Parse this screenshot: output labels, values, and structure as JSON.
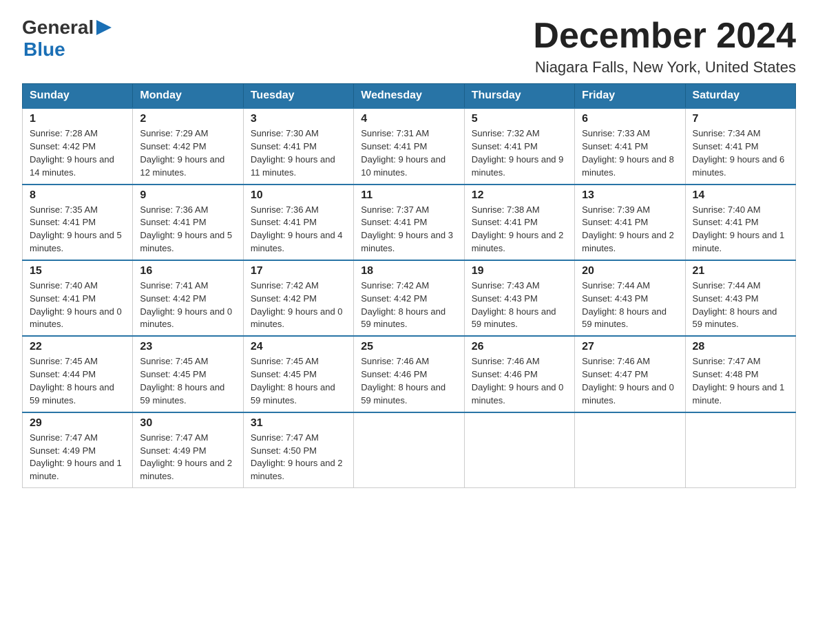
{
  "logo": {
    "general": "General",
    "blue": "Blue",
    "arrow_shape": "▶"
  },
  "header": {
    "title": "December 2024",
    "subtitle": "Niagara Falls, New York, United States"
  },
  "weekdays": [
    "Sunday",
    "Monday",
    "Tuesday",
    "Wednesday",
    "Thursday",
    "Friday",
    "Saturday"
  ],
  "weeks": [
    [
      {
        "day": "1",
        "sunrise": "7:28 AM",
        "sunset": "4:42 PM",
        "daylight": "9 hours and 14 minutes."
      },
      {
        "day": "2",
        "sunrise": "7:29 AM",
        "sunset": "4:42 PM",
        "daylight": "9 hours and 12 minutes."
      },
      {
        "day": "3",
        "sunrise": "7:30 AM",
        "sunset": "4:41 PM",
        "daylight": "9 hours and 11 minutes."
      },
      {
        "day": "4",
        "sunrise": "7:31 AM",
        "sunset": "4:41 PM",
        "daylight": "9 hours and 10 minutes."
      },
      {
        "day": "5",
        "sunrise": "7:32 AM",
        "sunset": "4:41 PM",
        "daylight": "9 hours and 9 minutes."
      },
      {
        "day": "6",
        "sunrise": "7:33 AM",
        "sunset": "4:41 PM",
        "daylight": "9 hours and 8 minutes."
      },
      {
        "day": "7",
        "sunrise": "7:34 AM",
        "sunset": "4:41 PM",
        "daylight": "9 hours and 6 minutes."
      }
    ],
    [
      {
        "day": "8",
        "sunrise": "7:35 AM",
        "sunset": "4:41 PM",
        "daylight": "9 hours and 5 minutes."
      },
      {
        "day": "9",
        "sunrise": "7:36 AM",
        "sunset": "4:41 PM",
        "daylight": "9 hours and 5 minutes."
      },
      {
        "day": "10",
        "sunrise": "7:36 AM",
        "sunset": "4:41 PM",
        "daylight": "9 hours and 4 minutes."
      },
      {
        "day": "11",
        "sunrise": "7:37 AM",
        "sunset": "4:41 PM",
        "daylight": "9 hours and 3 minutes."
      },
      {
        "day": "12",
        "sunrise": "7:38 AM",
        "sunset": "4:41 PM",
        "daylight": "9 hours and 2 minutes."
      },
      {
        "day": "13",
        "sunrise": "7:39 AM",
        "sunset": "4:41 PM",
        "daylight": "9 hours and 2 minutes."
      },
      {
        "day": "14",
        "sunrise": "7:40 AM",
        "sunset": "4:41 PM",
        "daylight": "9 hours and 1 minute."
      }
    ],
    [
      {
        "day": "15",
        "sunrise": "7:40 AM",
        "sunset": "4:41 PM",
        "daylight": "9 hours and 0 minutes."
      },
      {
        "day": "16",
        "sunrise": "7:41 AM",
        "sunset": "4:42 PM",
        "daylight": "9 hours and 0 minutes."
      },
      {
        "day": "17",
        "sunrise": "7:42 AM",
        "sunset": "4:42 PM",
        "daylight": "9 hours and 0 minutes."
      },
      {
        "day": "18",
        "sunrise": "7:42 AM",
        "sunset": "4:42 PM",
        "daylight": "8 hours and 59 minutes."
      },
      {
        "day": "19",
        "sunrise": "7:43 AM",
        "sunset": "4:43 PM",
        "daylight": "8 hours and 59 minutes."
      },
      {
        "day": "20",
        "sunrise": "7:44 AM",
        "sunset": "4:43 PM",
        "daylight": "8 hours and 59 minutes."
      },
      {
        "day": "21",
        "sunrise": "7:44 AM",
        "sunset": "4:43 PM",
        "daylight": "8 hours and 59 minutes."
      }
    ],
    [
      {
        "day": "22",
        "sunrise": "7:45 AM",
        "sunset": "4:44 PM",
        "daylight": "8 hours and 59 minutes."
      },
      {
        "day": "23",
        "sunrise": "7:45 AM",
        "sunset": "4:45 PM",
        "daylight": "8 hours and 59 minutes."
      },
      {
        "day": "24",
        "sunrise": "7:45 AM",
        "sunset": "4:45 PM",
        "daylight": "8 hours and 59 minutes."
      },
      {
        "day": "25",
        "sunrise": "7:46 AM",
        "sunset": "4:46 PM",
        "daylight": "8 hours and 59 minutes."
      },
      {
        "day": "26",
        "sunrise": "7:46 AM",
        "sunset": "4:46 PM",
        "daylight": "9 hours and 0 minutes."
      },
      {
        "day": "27",
        "sunrise": "7:46 AM",
        "sunset": "4:47 PM",
        "daylight": "9 hours and 0 minutes."
      },
      {
        "day": "28",
        "sunrise": "7:47 AM",
        "sunset": "4:48 PM",
        "daylight": "9 hours and 1 minute."
      }
    ],
    [
      {
        "day": "29",
        "sunrise": "7:47 AM",
        "sunset": "4:49 PM",
        "daylight": "9 hours and 1 minute."
      },
      {
        "day": "30",
        "sunrise": "7:47 AM",
        "sunset": "4:49 PM",
        "daylight": "9 hours and 2 minutes."
      },
      {
        "day": "31",
        "sunrise": "7:47 AM",
        "sunset": "4:50 PM",
        "daylight": "9 hours and 2 minutes."
      },
      null,
      null,
      null,
      null
    ]
  ]
}
